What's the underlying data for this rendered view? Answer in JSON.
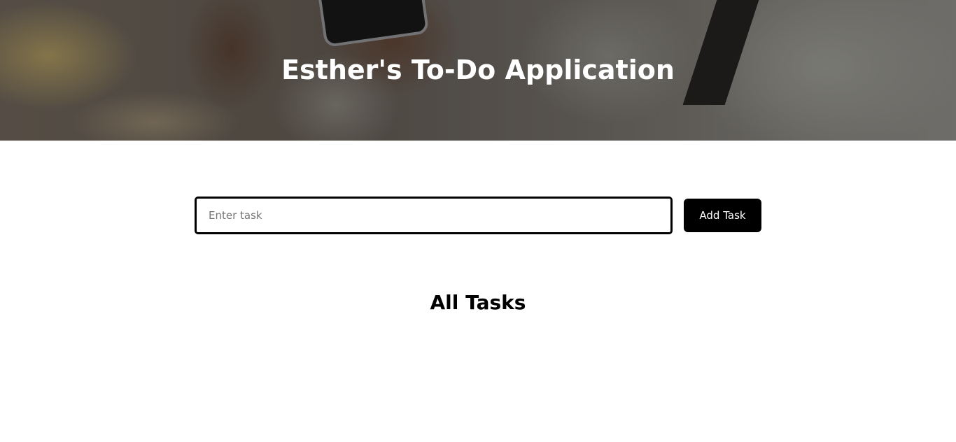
{
  "header": {
    "title": "Esther's To-Do Application"
  },
  "form": {
    "input_placeholder": "Enter task",
    "input_value": "",
    "add_button_label": "Add Task"
  },
  "tasks_section": {
    "heading": "All Tasks",
    "tasks": []
  },
  "colors": {
    "button_background": "#000000",
    "button_text": "#ffffff",
    "input_border": "#000000",
    "hero_title": "#ffffff"
  }
}
